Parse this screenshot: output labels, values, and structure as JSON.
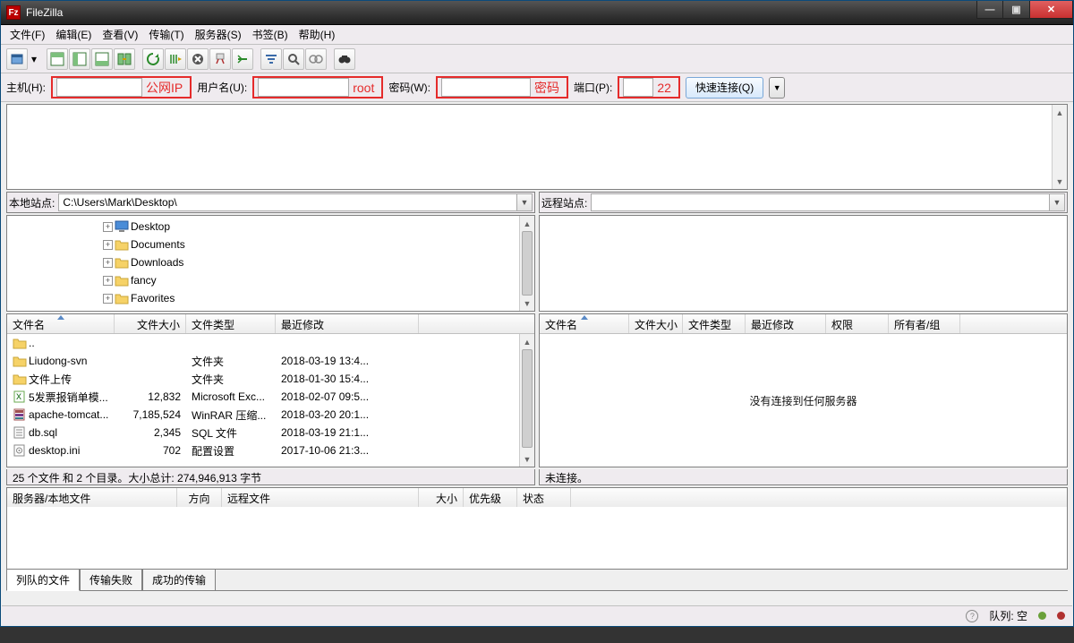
{
  "title": "FileZilla",
  "menus": [
    "文件(F)",
    "编辑(E)",
    "查看(V)",
    "传输(T)",
    "服务器(S)",
    "书签(B)",
    "帮助(H)"
  ],
  "quickconnect": {
    "host_label": "主机(H):",
    "host_annot": "公网IP",
    "user_label": "用户名(U):",
    "user_annot": "root",
    "pass_label": "密码(W):",
    "pass_annot": "密码",
    "port_label": "端口(P):",
    "port_annot": "22",
    "button": "快速连接(Q)"
  },
  "site": {
    "local_label": "本地站点:",
    "local_path": "C:\\Users\\Mark\\Desktop\\",
    "remote_label": "远程站点:",
    "remote_path": ""
  },
  "local_tree": [
    {
      "name": "Desktop",
      "icon": "monitor"
    },
    {
      "name": "Documents",
      "icon": "folder"
    },
    {
      "name": "Downloads",
      "icon": "folder"
    },
    {
      "name": "fancy",
      "icon": "folder"
    },
    {
      "name": "Favorites",
      "icon": "folder"
    }
  ],
  "local_cols": [
    "文件名",
    "文件大小",
    "文件类型",
    "最近修改"
  ],
  "remote_cols": [
    "文件名",
    "文件大小",
    "文件类型",
    "最近修改",
    "权限",
    "所有者/组"
  ],
  "local_files": [
    {
      "name": "..",
      "size": "",
      "type": "",
      "mod": "",
      "icon": "folder"
    },
    {
      "name": "Liudong-svn",
      "size": "",
      "type": "文件夹",
      "mod": "2018-03-19 13:4...",
      "icon": "folder"
    },
    {
      "name": "文件上传",
      "size": "",
      "type": "文件夹",
      "mod": "2018-01-30 15:4...",
      "icon": "folder"
    },
    {
      "name": "5发票报销单模...",
      "size": "12,832",
      "type": "Microsoft Exc...",
      "mod": "2018-02-07 09:5...",
      "icon": "xls"
    },
    {
      "name": "apache-tomcat...",
      "size": "7,185,524",
      "type": "WinRAR 压缩...",
      "mod": "2018-03-20 20:1...",
      "icon": "zip"
    },
    {
      "name": "db.sql",
      "size": "2,345",
      "type": "SQL 文件",
      "mod": "2018-03-19 21:1...",
      "icon": "sql"
    },
    {
      "name": "desktop.ini",
      "size": "702",
      "type": "配置设置",
      "mod": "2017-10-06 21:3...",
      "icon": "ini"
    }
  ],
  "local_summary": "25 个文件 和 2 个目录。大小总计: 274,946,913 字节",
  "remote_noconn": "没有连接到任何服务器",
  "remote_summary": "未连接。",
  "queue_cols": [
    "服务器/本地文件",
    "方向",
    "远程文件",
    "大小",
    "优先级",
    "状态"
  ],
  "tabs": [
    "列队的文件",
    "传输失败",
    "成功的传输"
  ],
  "status": {
    "queue": "队列: 空"
  }
}
